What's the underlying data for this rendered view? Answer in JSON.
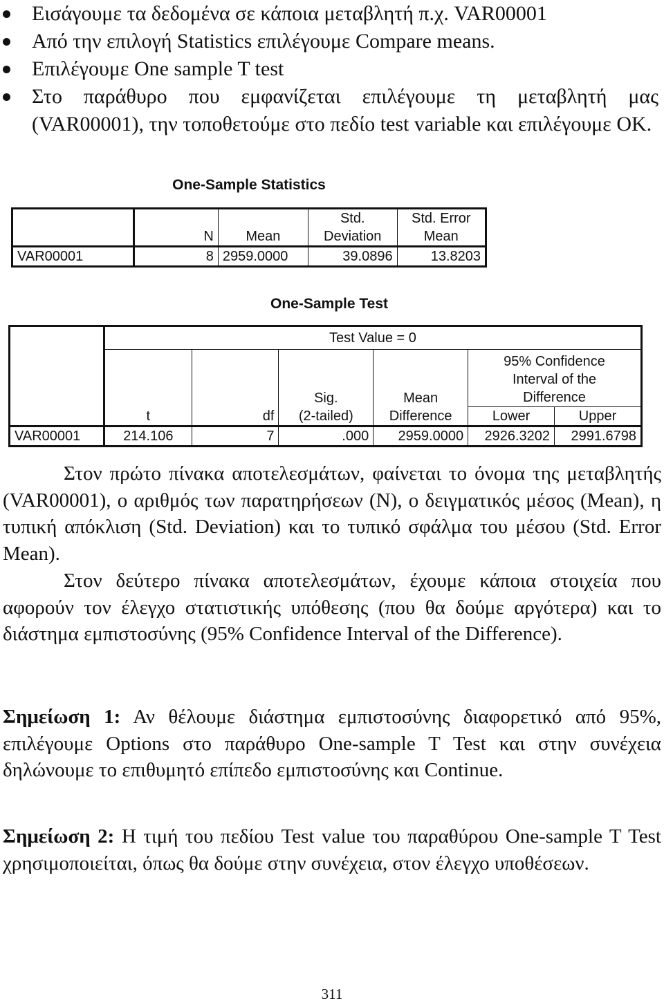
{
  "bullets": [
    "Εισάγουμε τα δεδομένα σε κάποια μεταβλητή π.χ. VAR00001",
    "Από την επιλογή Statistics επιλέγουμε Compare means.",
    "Επιλέγουμε One sample T test",
    "Στο παράθυρο που εμφανίζεται επιλέγουμε τη μεταβλητή μας (VAR00001), την τοποθετούμε στο πεδίο test variable και επιλέγουμε OK."
  ],
  "table1": {
    "title": "One-Sample Statistics",
    "headers": {
      "n": "N",
      "mean": "Mean",
      "std_dev_1": "Std.",
      "std_dev_2": "Deviation",
      "std_err_1": "Std. Error",
      "std_err_2": "Mean"
    },
    "row": {
      "label": "VAR00001",
      "n": "8",
      "mean": "2959.0000",
      "std_dev": "39.0896",
      "std_err": "13.8203"
    }
  },
  "table2": {
    "title": "One-Sample Test",
    "test_value": "Test Value = 0",
    "headers": {
      "t": "t",
      "df": "df",
      "sig_1": "Sig.",
      "sig_2": "(2-tailed)",
      "mean_diff_1": "Mean",
      "mean_diff_2": "Difference",
      "ci_1": "95% Confidence",
      "ci_2": "Interval of the",
      "ci_3": "Difference",
      "lower": "Lower",
      "upper": "Upper"
    },
    "row": {
      "label": "VAR00001",
      "t": "214.106",
      "df": "7",
      "sig": ".000",
      "mean_diff": "2959.0000",
      "lower": "2926.3202",
      "upper": "2991.6798"
    }
  },
  "paragraphs": [
    "Στον πρώτο πίνακα αποτελεσμάτων, φαίνεται το όνομα της μεταβλητής (VAR00001), ο αριθμός των παρατηρήσεων (N), ο δειγματικός μέσος (Mean), η τυπική απόκλιση (Std. Deviation) και το τυπικό σφάλμα του μέσου (Std. Error  Mean).",
    "Στον δεύτερο πίνακα αποτελεσμάτων, έχουμε κάποια στοιχεία που αφορούν τον έλεγχο στατιστικής υπόθεσης (που θα δούμε αργότερα) και το διάστημα εμπιστοσύνης (95% Confidence Interval of the Difference)."
  ],
  "notes": [
    {
      "label": "Σημείωση 1:",
      "text": " Αν θέλουμε διάστημα εμπιστοσύνης διαφορετικό από 95%, επιλέγουμε Options στο παράθυρο One-sample T Test και στην συνέχεια δηλώνουμε το επιθυμητό επίπεδο εμπιστοσύνης και Continue."
    },
    {
      "label": "Σημείωση 2:",
      "text": " Η τιμή του πεδίου Test value του παραθύρου One-sample T Test χρησιμοποιείται, όπως θα δούμε στην συνέχεια, στον έλεγχο υποθέσεων."
    }
  ],
  "page_number": "311"
}
